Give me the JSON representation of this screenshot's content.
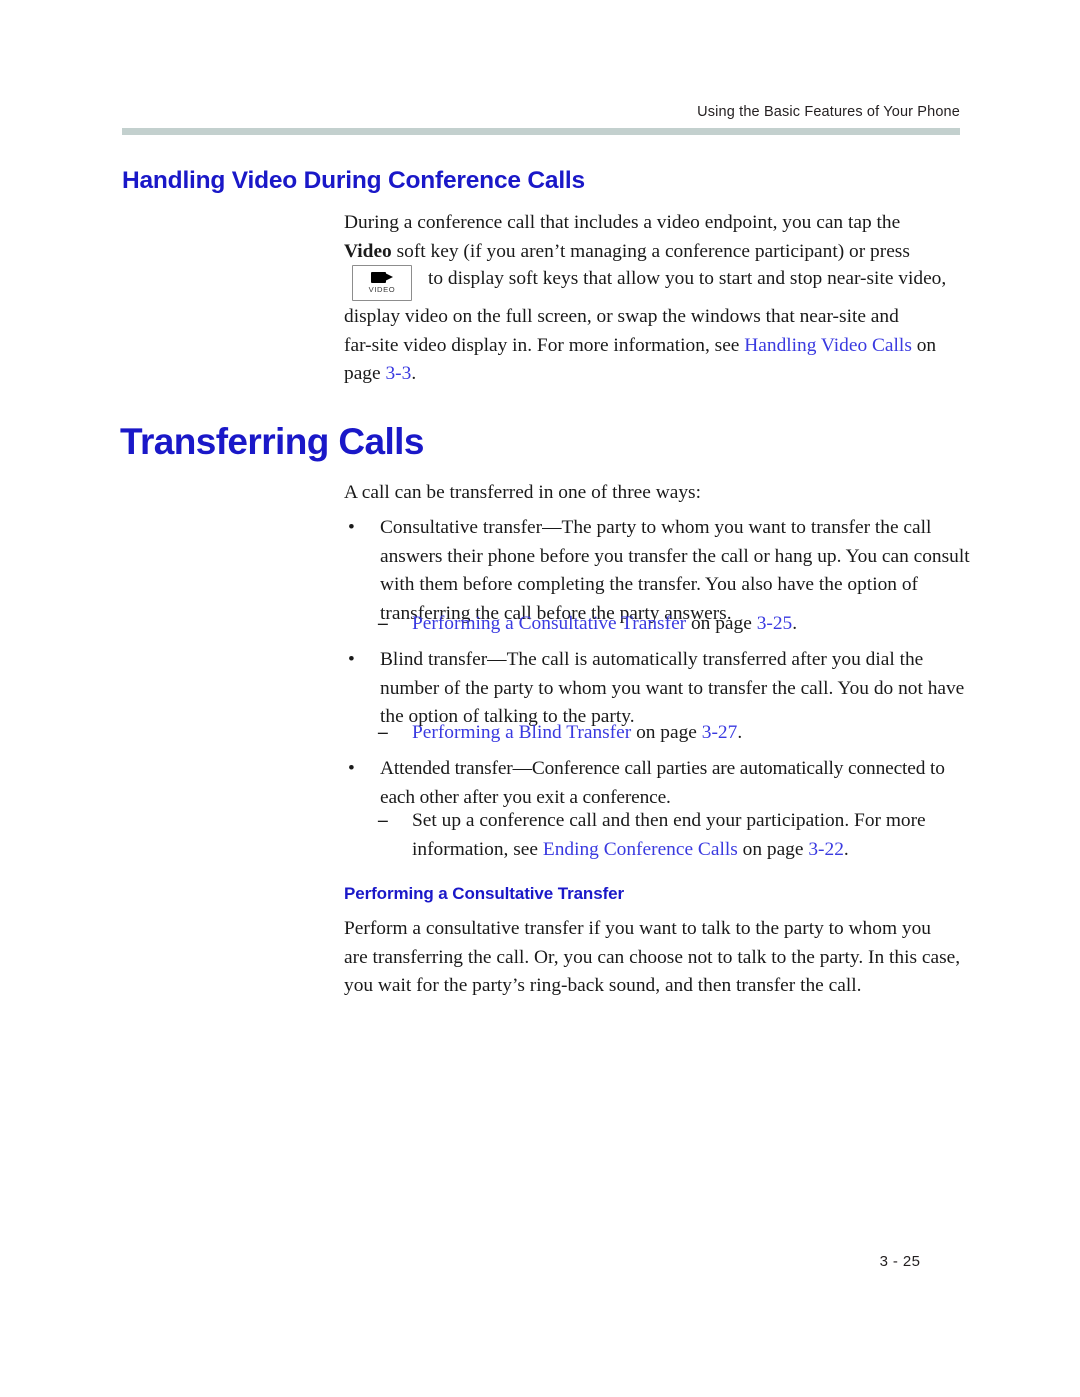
{
  "header": {
    "running_title": "Using the Basic Features of Your Phone"
  },
  "colors": {
    "heading_blue": "#1a18c8",
    "link_blue": "#3a3ae0",
    "rule_gray": "#c3d0ce",
    "body_black": "#1a1a1a"
  },
  "sections": {
    "video_conference": {
      "heading": "Handling Video During Conference Calls",
      "para1_line1": "During a conference call that includes a video endpoint, you can tap the",
      "para1_bold": "Video",
      "para1_line2_rest": " soft key (if you aren’t managing a conference participant) or press",
      "key_graphic": {
        "icon_name": "video-camera-icon",
        "label": "VIDEO"
      },
      "after_key_text": "to display soft keys that allow you to start and stop near-site video,",
      "para2_line1": "display video on the full screen, or swap the windows that near-site and",
      "para2_line2_before": "far-site video display in. For more information, see ",
      "para2_link": "Handling Video Calls",
      "para2_line2_after": " on",
      "para2_line3_before": "page ",
      "para2_page_ref": "3-3",
      "para2_line3_after": "."
    },
    "transferring_calls": {
      "heading": "Transferring Calls",
      "intro": "A call can be transferred in one of three ways:",
      "bullets": [
        {
          "marker": "•",
          "term": "Consultative transfer",
          "dash": "—",
          "text": "The party to whom you want to transfer the call answers their phone before you transfer the call or hang up. You can consult with them before completing the transfer. You also have the option of transferring the call before the party answers."
        },
        {
          "marker": "•",
          "term": "Blind transfer",
          "dash": "—",
          "text": "The call is automatically transferred after you dial the number of the party to whom you want to transfer the call. You do not have the option of talking to the party."
        },
        {
          "marker": "•",
          "term": "Attended transfer",
          "dash": "—",
          "text": "Conference call parties are automatically connected to each other after you exit a conference."
        }
      ],
      "subrefs": [
        {
          "marker": "–",
          "link": "Performing a Consultative Transfer",
          "middle": " on page ",
          "page_ref": "3-25",
          "end": "."
        },
        {
          "marker": "–",
          "link": "Performing a Blind Transfer",
          "middle": " on page ",
          "page_ref": "3-27",
          "end": "."
        },
        {
          "marker": "–",
          "prefix": "Set up a conference call and then end your participation. For more information, see ",
          "link": "Ending Conference Calls",
          "middle": " on page ",
          "page_ref": "3-22",
          "end": "."
        }
      ]
    },
    "consultative_transfer": {
      "heading": "Performing a Consultative Transfer",
      "para_line1": "Perform a consultative transfer if you want to talk to the party to whom you",
      "para_line2": "are transferring the call. Or, you can choose not to talk to the party. In this case,",
      "para_line3": "you wait for the party’s ring-back sound, and then transfer the call."
    }
  },
  "footer": {
    "page_number": "3 - 25"
  }
}
